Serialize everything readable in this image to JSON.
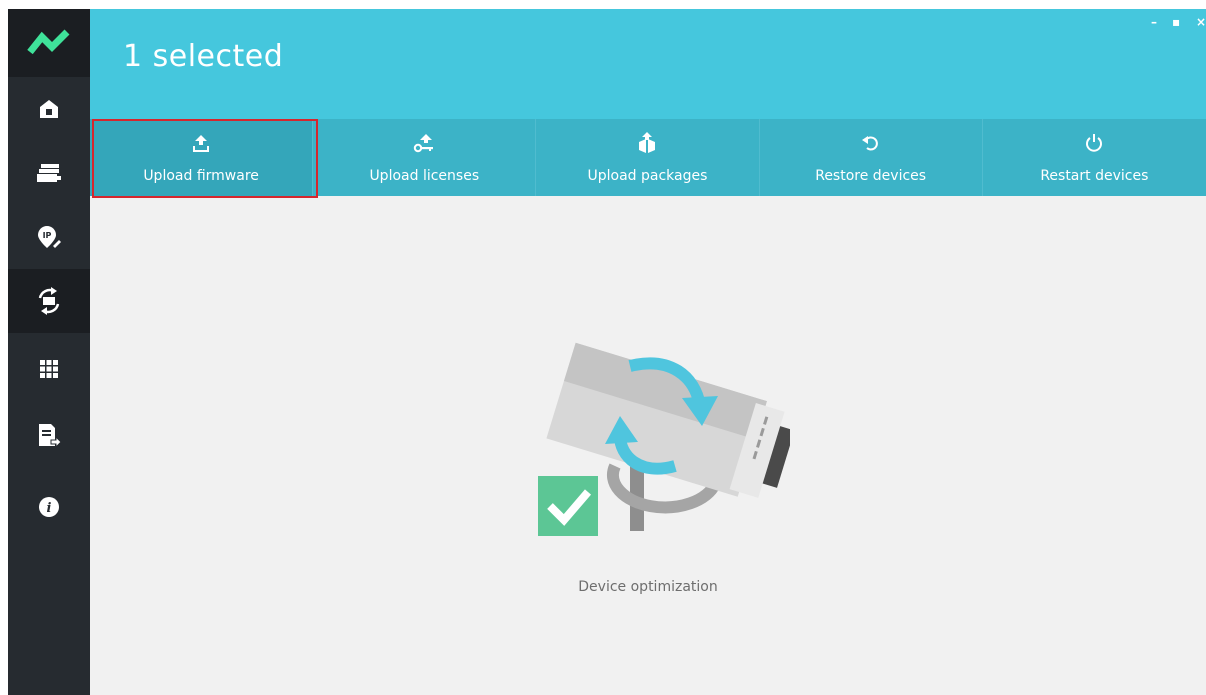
{
  "header": {
    "title": "1 selected"
  },
  "window_controls": {
    "minimize": "–",
    "maximize": "▪",
    "close": "×"
  },
  "sidebar": {
    "items": [
      {
        "icon": "home-icon"
      },
      {
        "icon": "devices-icon"
      },
      {
        "icon": "ip-settings-icon"
      },
      {
        "icon": "device-maintenance-icon",
        "active": true
      },
      {
        "icon": "grid-apps-icon"
      },
      {
        "icon": "export-report-icon"
      },
      {
        "icon": "info-icon"
      }
    ]
  },
  "toolbar": {
    "items": [
      {
        "label": "Upload firmware",
        "icon": "upload-firmware-icon",
        "selected": true
      },
      {
        "label": "Upload licenses",
        "icon": "upload-license-icon"
      },
      {
        "label": "Upload packages",
        "icon": "upload-packages-icon"
      },
      {
        "label": "Restore devices",
        "icon": "restore-icon"
      },
      {
        "label": "Restart devices",
        "icon": "power-icon"
      }
    ]
  },
  "main": {
    "empty_state_label": "Device optimization"
  },
  "colors": {
    "header": "#45c7dd",
    "toolbar": "#3cb3c7",
    "sidebar": "#262b30",
    "highlight": "#d6262d",
    "check": "#5cc695"
  }
}
